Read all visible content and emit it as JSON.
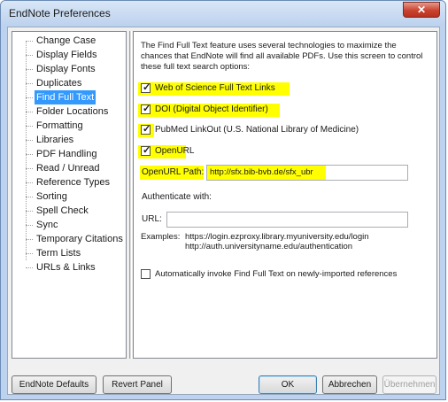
{
  "window": {
    "title": "EndNote Preferences",
    "close_glyph": "✕"
  },
  "sidebar": {
    "items": [
      {
        "label": "Change Case"
      },
      {
        "label": "Display Fields"
      },
      {
        "label": "Display Fonts"
      },
      {
        "label": "Duplicates"
      },
      {
        "label": "Find Full Text",
        "selected": true
      },
      {
        "label": "Folder Locations"
      },
      {
        "label": "Formatting"
      },
      {
        "label": "Libraries"
      },
      {
        "label": "PDF Handling"
      },
      {
        "label": "Read / Unread"
      },
      {
        "label": "Reference Types"
      },
      {
        "label": "Sorting"
      },
      {
        "label": "Spell Check"
      },
      {
        "label": "Sync"
      },
      {
        "label": "Temporary Citations"
      },
      {
        "label": "Term Lists"
      },
      {
        "label": "URLs & Links"
      }
    ]
  },
  "panel": {
    "intro": "The Find Full Text feature uses several technologies to maximize the chances that EndNote will find all available PDFs. Use this screen to control these full text search options:",
    "options": [
      {
        "label": "Web of Science Full Text Links",
        "checked": true
      },
      {
        "label": "DOI (Digital Object Identifier)",
        "checked": true
      },
      {
        "label": "PubMed LinkOut (U.S. National Library of Medicine)",
        "checked": true
      },
      {
        "label": "OpenURL",
        "checked": true
      }
    ],
    "check_glyph": "✓",
    "openurl_path_label": "OpenURL Path:",
    "openurl_path_value": "http://sfx.bib-bvb.de/sfx_ubr",
    "authenticate_label": "Authenticate with:",
    "url_label": "URL:",
    "url_value": "",
    "examples_label": "Examples:",
    "examples": [
      "https://login.ezproxy.library.myuniversity.edu/login",
      "http://auth.universityname.edu/authentication"
    ],
    "auto_invoke_label": "Automatically invoke Find Full Text on newly-imported references",
    "auto_invoke_checked": false
  },
  "buttons": {
    "endnote_defaults": "EndNote Defaults",
    "revert_panel": "Revert Panel",
    "ok": "OK",
    "cancel": "Abbrechen",
    "apply": "Übernehmen"
  },
  "colors": {
    "highlight": "#ffff00",
    "selection": "#3399ff",
    "close_button": "#c9432f"
  }
}
